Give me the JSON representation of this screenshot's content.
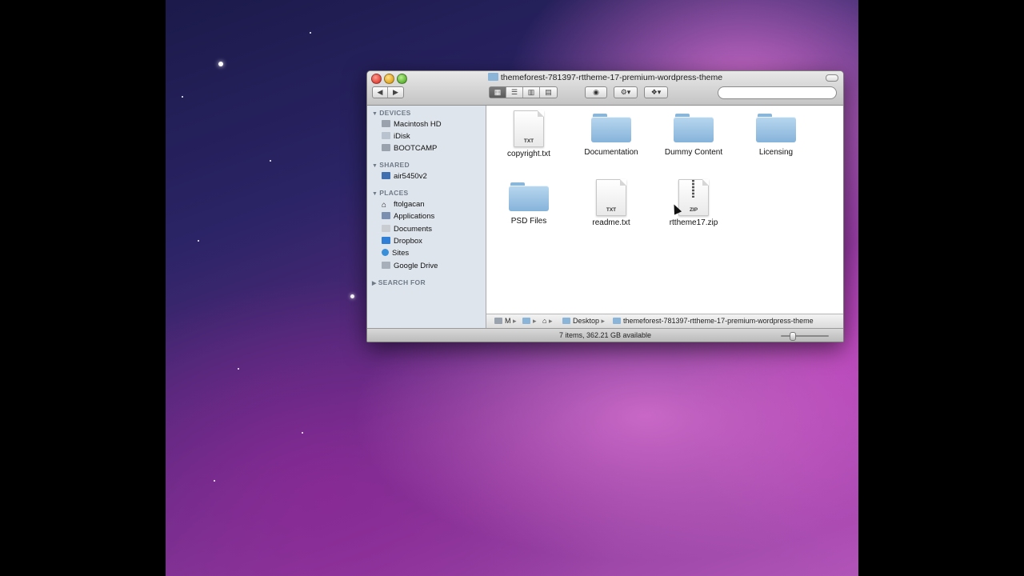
{
  "window": {
    "title": "themeforest-781397-rttheme-17-premium-wordpress-theme"
  },
  "toolbar": {
    "back_icon": "chevron-left-icon",
    "forward_icon": "chevron-right-icon",
    "view_modes": [
      "icon-view",
      "list-view",
      "column-view",
      "coverflow-view"
    ],
    "active_view": "icon-view",
    "search_placeholder": ""
  },
  "sidebar": {
    "sections": [
      {
        "label": "DEVICES",
        "items": [
          {
            "label": "Macintosh HD",
            "icon": "hard-drive-icon"
          },
          {
            "label": "iDisk",
            "icon": "idisk-icon"
          },
          {
            "label": "BOOTCAMP",
            "icon": "hard-drive-icon"
          }
        ]
      },
      {
        "label": "SHARED",
        "items": [
          {
            "label": "air5450v2",
            "icon": "computer-icon"
          }
        ]
      },
      {
        "label": "PLACES",
        "items": [
          {
            "label": "ftolgacan",
            "icon": "home-icon"
          },
          {
            "label": "Applications",
            "icon": "applications-icon"
          },
          {
            "label": "Documents",
            "icon": "documents-folder-icon"
          },
          {
            "label": "Dropbox",
            "icon": "dropbox-icon"
          },
          {
            "label": "Sites",
            "icon": "globe-icon"
          },
          {
            "label": "Google Drive",
            "icon": "folder-icon"
          }
        ]
      },
      {
        "label": "SEARCH FOR",
        "items": []
      }
    ]
  },
  "files": [
    {
      "name": "copyright.txt",
      "kind": "TXT"
    },
    {
      "name": "Documentation",
      "kind": "folder"
    },
    {
      "name": "Dummy Content",
      "kind": "folder"
    },
    {
      "name": "Licensing",
      "kind": "folder"
    },
    {
      "name": "PSD Files",
      "kind": "folder"
    },
    {
      "name": "readme.txt",
      "kind": "TXT"
    },
    {
      "name": "rttheme17.zip",
      "kind": "ZIP"
    }
  ],
  "pathbar": {
    "crumbs": [
      "M",
      "",
      "",
      "Desktop",
      "themeforest-781397-rttheme-17-premium-wordpress-theme"
    ]
  },
  "status": {
    "text": "7 items, 362.21 GB available"
  },
  "colors": {
    "sidebar_bg": "#dfe5ed",
    "folder_blue": "#86b3da",
    "accent": "#5a5a5a"
  }
}
